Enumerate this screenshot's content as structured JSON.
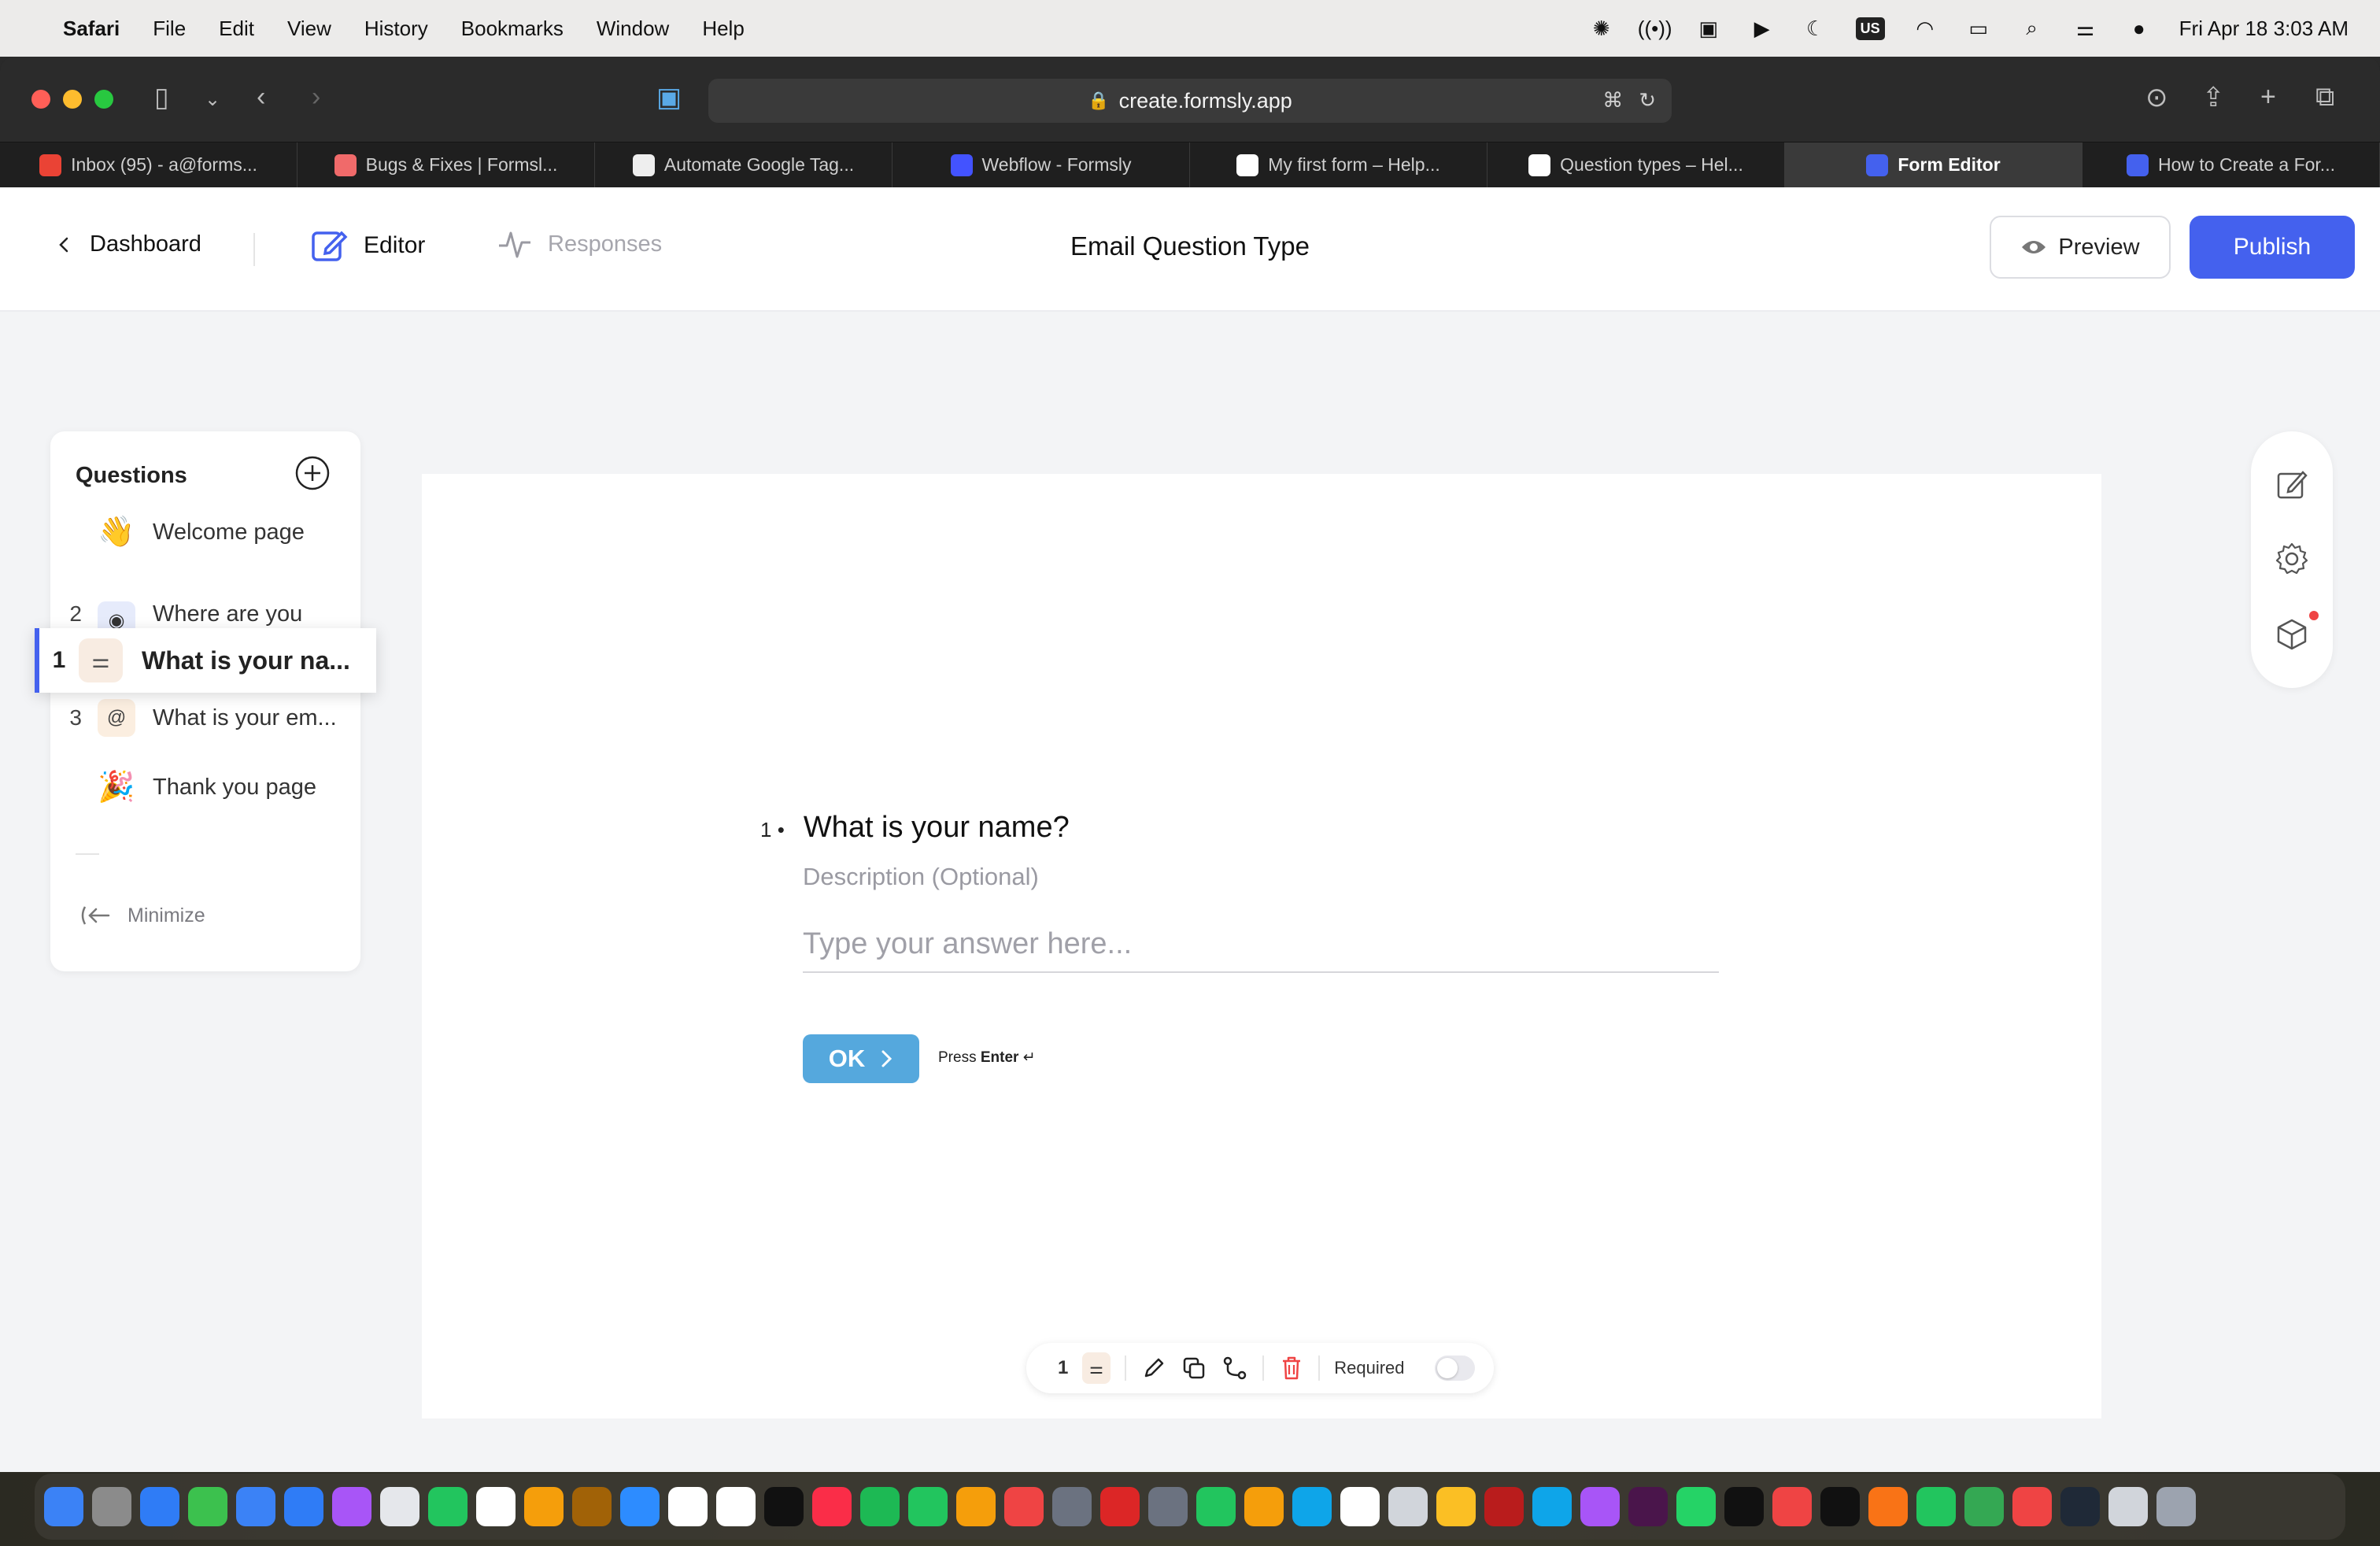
{
  "menubar": {
    "app": "Safari",
    "items": [
      "File",
      "Edit",
      "View",
      "History",
      "Bookmarks",
      "Window",
      "Help"
    ],
    "input_badge": "US",
    "datetime": "Fri Apr 18  3:03 AM"
  },
  "browser": {
    "url": "create.formsly.app",
    "tabs": [
      {
        "label": "Inbox (95) - a@forms...",
        "color": "#ea4335"
      },
      {
        "label": "Bugs & Fixes | Formsl...",
        "color": "#f06a6a"
      },
      {
        "label": "Automate Google Tag...",
        "color": "#eeeeee"
      },
      {
        "label": "Webflow - Formsly",
        "color": "#4353ff"
      },
      {
        "label": "My first form – Help...",
        "color": "#ffffff"
      },
      {
        "label": "Question types – Hel...",
        "color": "#ffffff"
      },
      {
        "label": "Form Editor",
        "color": "#4461ee",
        "active": true
      },
      {
        "label": "How to Create a For...",
        "color": "#4461ee"
      }
    ]
  },
  "header": {
    "dashboard_label": "Dashboard",
    "editor_label": "Editor",
    "responses_label": "Responses",
    "form_title": "Email Question Type",
    "preview_label": "Preview",
    "publish_label": "Publish"
  },
  "questions_panel": {
    "title": "Questions",
    "welcome": {
      "emoji": "👋",
      "label": "Welcome page"
    },
    "items": [
      {
        "num": "2",
        "icon": "◉",
        "label": "Where are you"
      },
      {
        "num": "3",
        "icon": "@",
        "label": "What is your em..."
      }
    ],
    "dragging": {
      "num": "1",
      "icon": "⚌",
      "label": "What is your na..."
    },
    "thank_you": {
      "emoji": "🎉",
      "label": "Thank you page"
    },
    "minimize_label": "Minimize"
  },
  "question": {
    "number": "1",
    "arrow": "•",
    "title": "What is your name?",
    "description_placeholder": "Description (Optional)",
    "answer_placeholder": "Type your answer here...",
    "ok_label": "OK",
    "press_label": "Press",
    "enter_label": "Enter"
  },
  "question_toolbar": {
    "number": "1",
    "required_label": "Required"
  },
  "dock": {
    "apps": [
      "#3b82f6",
      "#8b8b8b",
      "#2f7cf6",
      "#3cc14e",
      "#3b82f6",
      "#2f7cf6",
      "#a855f7",
      "#e5e7eb",
      "#22c55e",
      "#ffffff",
      "#f59e0b",
      "#a16207",
      "#2d8cff",
      "#ffffff",
      "#ffffff",
      "#111111",
      "#fa2d48",
      "#1db954",
      "#22c55e",
      "#f59e0b",
      "#ef4444",
      "#6b7280",
      "#dc2626",
      "#6b7280",
      "#22c55e",
      "#f59e0b",
      "#0ea5e9",
      "#ffffff",
      "#d1d5db",
      "#fbbf24",
      "#b91c1c",
      "#0ea5e9",
      "#a855f7",
      "#4a154b",
      "#25d366",
      "#111111",
      "#ef4444",
      "#111111",
      "#f97316",
      "#22c55e",
      "#34a853",
      "#ef4444",
      "#1f2937",
      "#d1d5db",
      "#9ca3af"
    ]
  }
}
